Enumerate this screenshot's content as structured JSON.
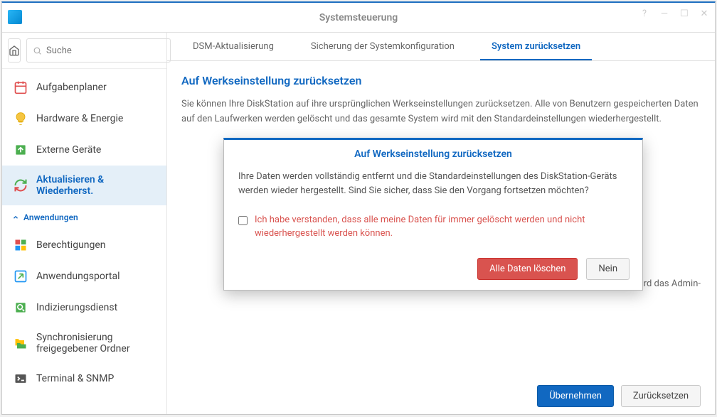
{
  "window": {
    "title": "Systemsteuerung"
  },
  "search": {
    "placeholder": "Suche"
  },
  "sidebar": {
    "items": [
      {
        "label": "Aufgabenplaner"
      },
      {
        "label": "Hardware & Energie"
      },
      {
        "label": "Externe Geräte"
      },
      {
        "label": "Aktualisieren & Wiederherst."
      },
      {
        "label": "Berechtigungen"
      },
      {
        "label": "Anwendungsportal"
      },
      {
        "label": "Indizierungsdienst"
      },
      {
        "label": "Synchronisierung freigegebener Ordner"
      },
      {
        "label": "Terminal & SNMP"
      }
    ],
    "section_label": "Anwendungen"
  },
  "tabs": {
    "dsm": "DSM-Aktualisierung",
    "backup": "Sicherung der Systemkonfiguration",
    "reset": "System zurücksetzen"
  },
  "content": {
    "heading": "Auf Werkseinstellung zurücksetzen",
    "paragraph": "Sie können Ihre DiskStation auf ihre ursprünglichen Werkseinstellungen zurücksetzen. Alle von Benutzern gespeicherten Daten auf den Laufwerken werden gelöscht und das gesamte System wird mit den Standardeinstellungen wiederhergestellt.",
    "note_partial": "ckt halten, wird das Admin-"
  },
  "footer": {
    "apply": "Übernehmen",
    "reset": "Zurücksetzen"
  },
  "modal": {
    "title": "Auf Werkseinstellung zurücksetzen",
    "body": "Ihre Daten werden vollständig entfernt und die Standardeinstellungen des DiskStation-Geräts werden wieder hergestellt. Sind Sie sicher, dass Sie den Vorgang fortsetzen möchten?",
    "check_label": "Ich habe verstanden, dass alle meine Daten für immer gelöscht werden und nicht wiederhergestellt werden können.",
    "delete_btn": "Alle Daten löschen",
    "no_btn": "Nein"
  }
}
